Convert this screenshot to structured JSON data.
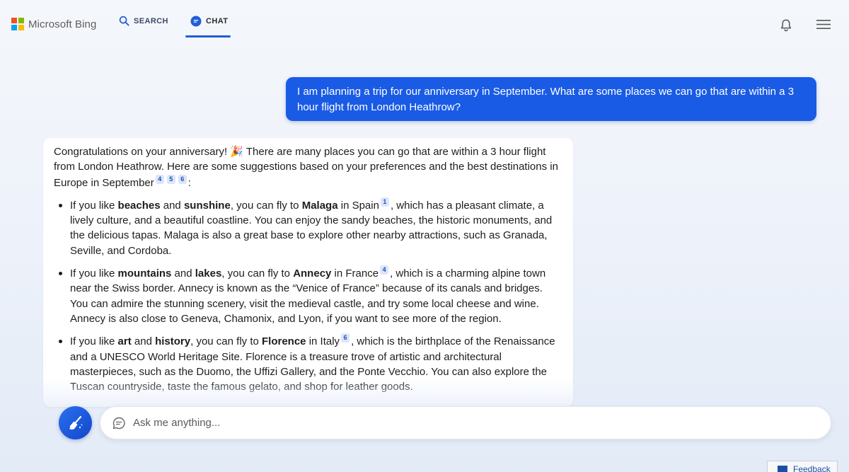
{
  "header": {
    "logo_text": "Microsoft Bing",
    "logo_colors": [
      "#f25022",
      "#7fba00",
      "#00a4ef",
      "#ffb900"
    ],
    "tabs": [
      {
        "label": "SEARCH",
        "icon": "search-icon",
        "active": false
      },
      {
        "label": "CHAT",
        "icon": "chat-icon",
        "active": true
      }
    ],
    "right_icons": [
      "bell-icon",
      "hamburger-menu-icon"
    ],
    "accent_color": "#1f5fd6"
  },
  "user_message": {
    "text": "I am planning a trip for our anniversary in September. What are some places we can go that are within a 3 hour flight from London Heathrow?",
    "bubble_color": "#1a5be6"
  },
  "bot_response": {
    "intro_a": "Congratulations on your anniversary! ",
    "intro_emoji": "🎉",
    "intro_b": " There are many places you can go that are within a 3 hour flight from London Heathrow. Here are some suggestions based on your preferences and the best destinations in Europe in September",
    "intro_cites": [
      "4",
      "5",
      "6"
    ],
    "intro_end": ":",
    "items": [
      {
        "t1": "If you like ",
        "b1": "beaches",
        "t2": " and ",
        "b2": "sunshine",
        "t3": ", you can fly to ",
        "dest": "Malaga",
        "t4": " in Spain",
        "cite": "1",
        "rest": ", which has a pleasant climate, a lively culture, and a beautiful coastline. You can enjoy the sandy beaches, the historic monuments, and the delicious tapas. Malaga is also a great base to explore other nearby attractions, such as Granada, Seville, and Cordoba."
      },
      {
        "t1": "If you like ",
        "b1": "mountains",
        "t2": " and ",
        "b2": "lakes",
        "t3": ", you can fly to ",
        "dest": "Annecy",
        "t4": " in France",
        "cite": "4",
        "rest": ", which is a charming alpine town near the Swiss border. Annecy is known as the “Venice of France” because of its canals and bridges. You can admire the stunning scenery, visit the medieval castle, and try some local cheese and wine. Annecy is also close to Geneva, Chamonix, and Lyon, if you want to see more of the region."
      },
      {
        "t1": "If you like ",
        "b1": "art",
        "t2": " and ",
        "b2": "history",
        "t3": ", you can fly to ",
        "dest": "Florence",
        "t4": " in Italy",
        "cite": "6",
        "rest": ", which is the birthplace of the Renaissance and a UNESCO World Heritage Site. Florence is a treasure trove of artistic and architectural masterpieces, such as the Duomo, the Uffizi Gallery, and the Ponte Vecchio. You can also explore the Tuscan countryside, taste the famous gelato, and shop for leather goods."
      }
    ]
  },
  "composer": {
    "new_topic_icon": "broom-icon",
    "placeholder": "Ask me anything...",
    "input_icon": "chat-bubble-icon"
  },
  "feedback": {
    "label": "Feedback"
  }
}
